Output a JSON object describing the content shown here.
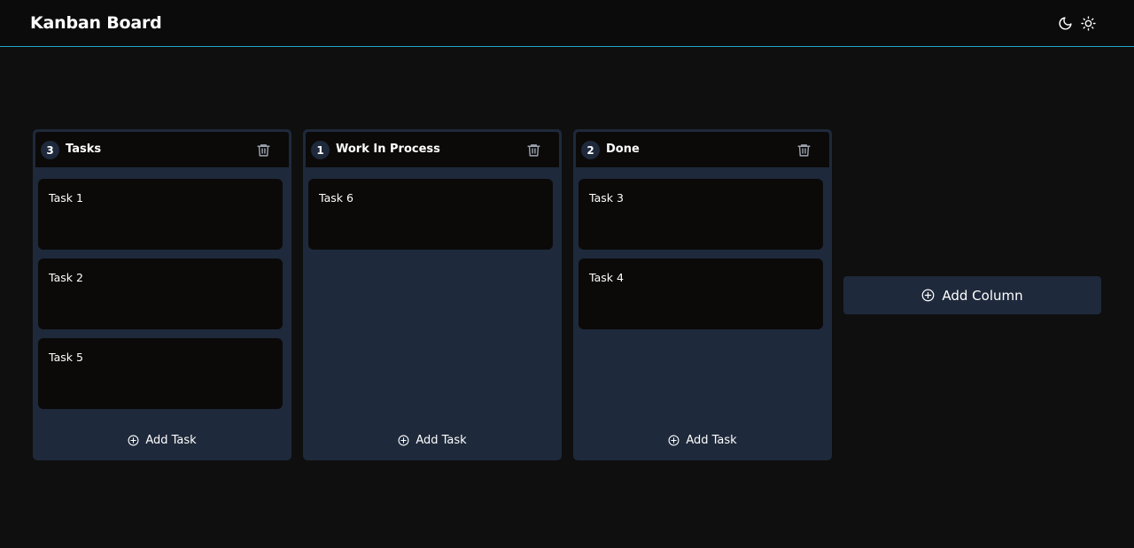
{
  "header": {
    "title": "Kanban Board",
    "theme_icons": [
      "moon-icon",
      "sun-icon"
    ]
  },
  "columns": [
    {
      "count": "3",
      "title": "Tasks",
      "tasks": [
        "Task 1",
        "Task 2",
        "Task 5"
      ],
      "add_task_label": "Add Task"
    },
    {
      "count": "1",
      "title": "Work In Process",
      "tasks": [
        "Task 6"
      ],
      "add_task_label": "Add Task"
    },
    {
      "count": "2",
      "title": "Done",
      "tasks": [
        "Task 3",
        "Task 4"
      ],
      "add_task_label": "Add Task"
    }
  ],
  "add_column_label": "Add Column",
  "colors": {
    "background": "#0f0f0f",
    "header_bg": "#0b0b0b",
    "header_border": "#22a6c5",
    "column_bg": "#1e293b",
    "card_bg": "#0b0a09",
    "text": "#ffffff"
  }
}
